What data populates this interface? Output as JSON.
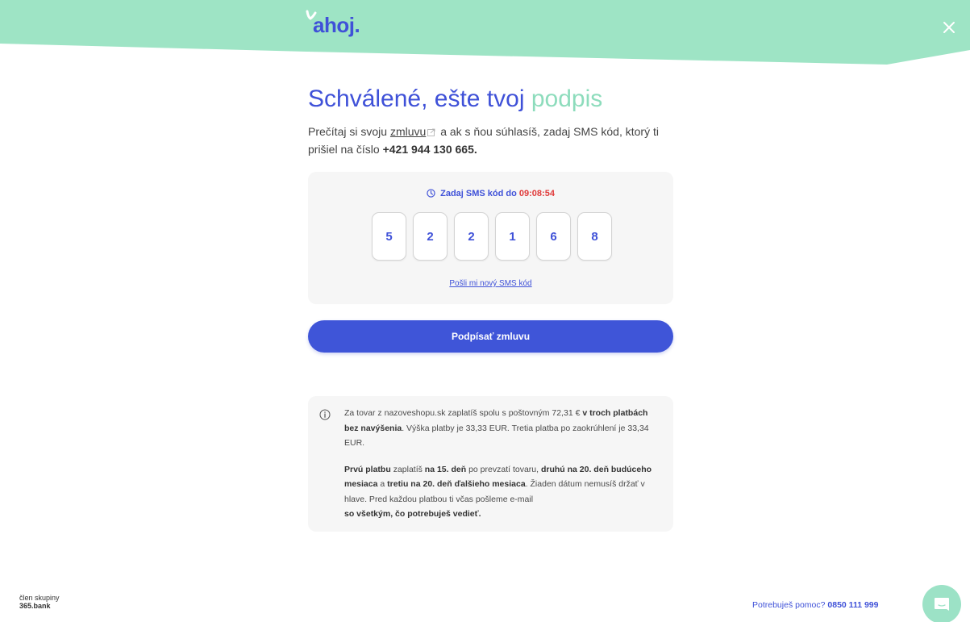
{
  "header": {
    "logo_text": "ahoj",
    "logo_dot": ".",
    "close_label": "×"
  },
  "colors": {
    "header_bg": "#9ee4c5",
    "primary": "#3f51d8",
    "accent": "#8ddcbc",
    "timer_red": "#e03a3a"
  },
  "title": {
    "main": "Schválené, ešte tvoj",
    "accent": "podpis"
  },
  "intro": {
    "before_link": "Prečítaj si svoju",
    "link": "zmluvu",
    "after_link": "a ak s ňou súhlasíš, zadaj SMS kód, ktorý ti prišiel na číslo",
    "phone": "+421 944 130 665."
  },
  "sms": {
    "timer_label": "Zadaj SMS kód do",
    "timer_value": "09:08:54",
    "digits": [
      "5",
      "2",
      "2",
      "1",
      "6",
      "8"
    ],
    "resend": "Pošli mi nový SMS kód"
  },
  "sign_button": "Podpísať zmluvu",
  "info": {
    "p1_a": "Za tovar z nazoveshopu.sk zaplatíš spolu s poštovným 72,31 €",
    "p1_b": "v troch platbách bez navýšenia",
    "p1_c": ". Výška platby je 33,33 EUR. Tretia platba po zaokrúhlení je 33,34 EUR.",
    "p2_a": "Prvú platbu",
    "p2_b": "zaplatíš",
    "p2_c": "na 15. deň",
    "p2_d": "po prevzatí tovaru,",
    "p2_e": "druhú na 20. deň budúceho mesiaca",
    "p2_f": "a",
    "p2_g": "tretiu na 20. deň ďalšieho mesiaca",
    "p2_h": ". Žiaden dátum nemusíš držať v hlave. Pred každou platbou ti včas pošleme e-mail",
    "p2_i": "so všetkým, čo potrebuješ vedieť."
  },
  "footer": {
    "member_label": "člen skupiny",
    "member_brand": "365.bank",
    "help_label": "Potrebuješ pomoc?",
    "help_phone": "0850 111 999"
  }
}
